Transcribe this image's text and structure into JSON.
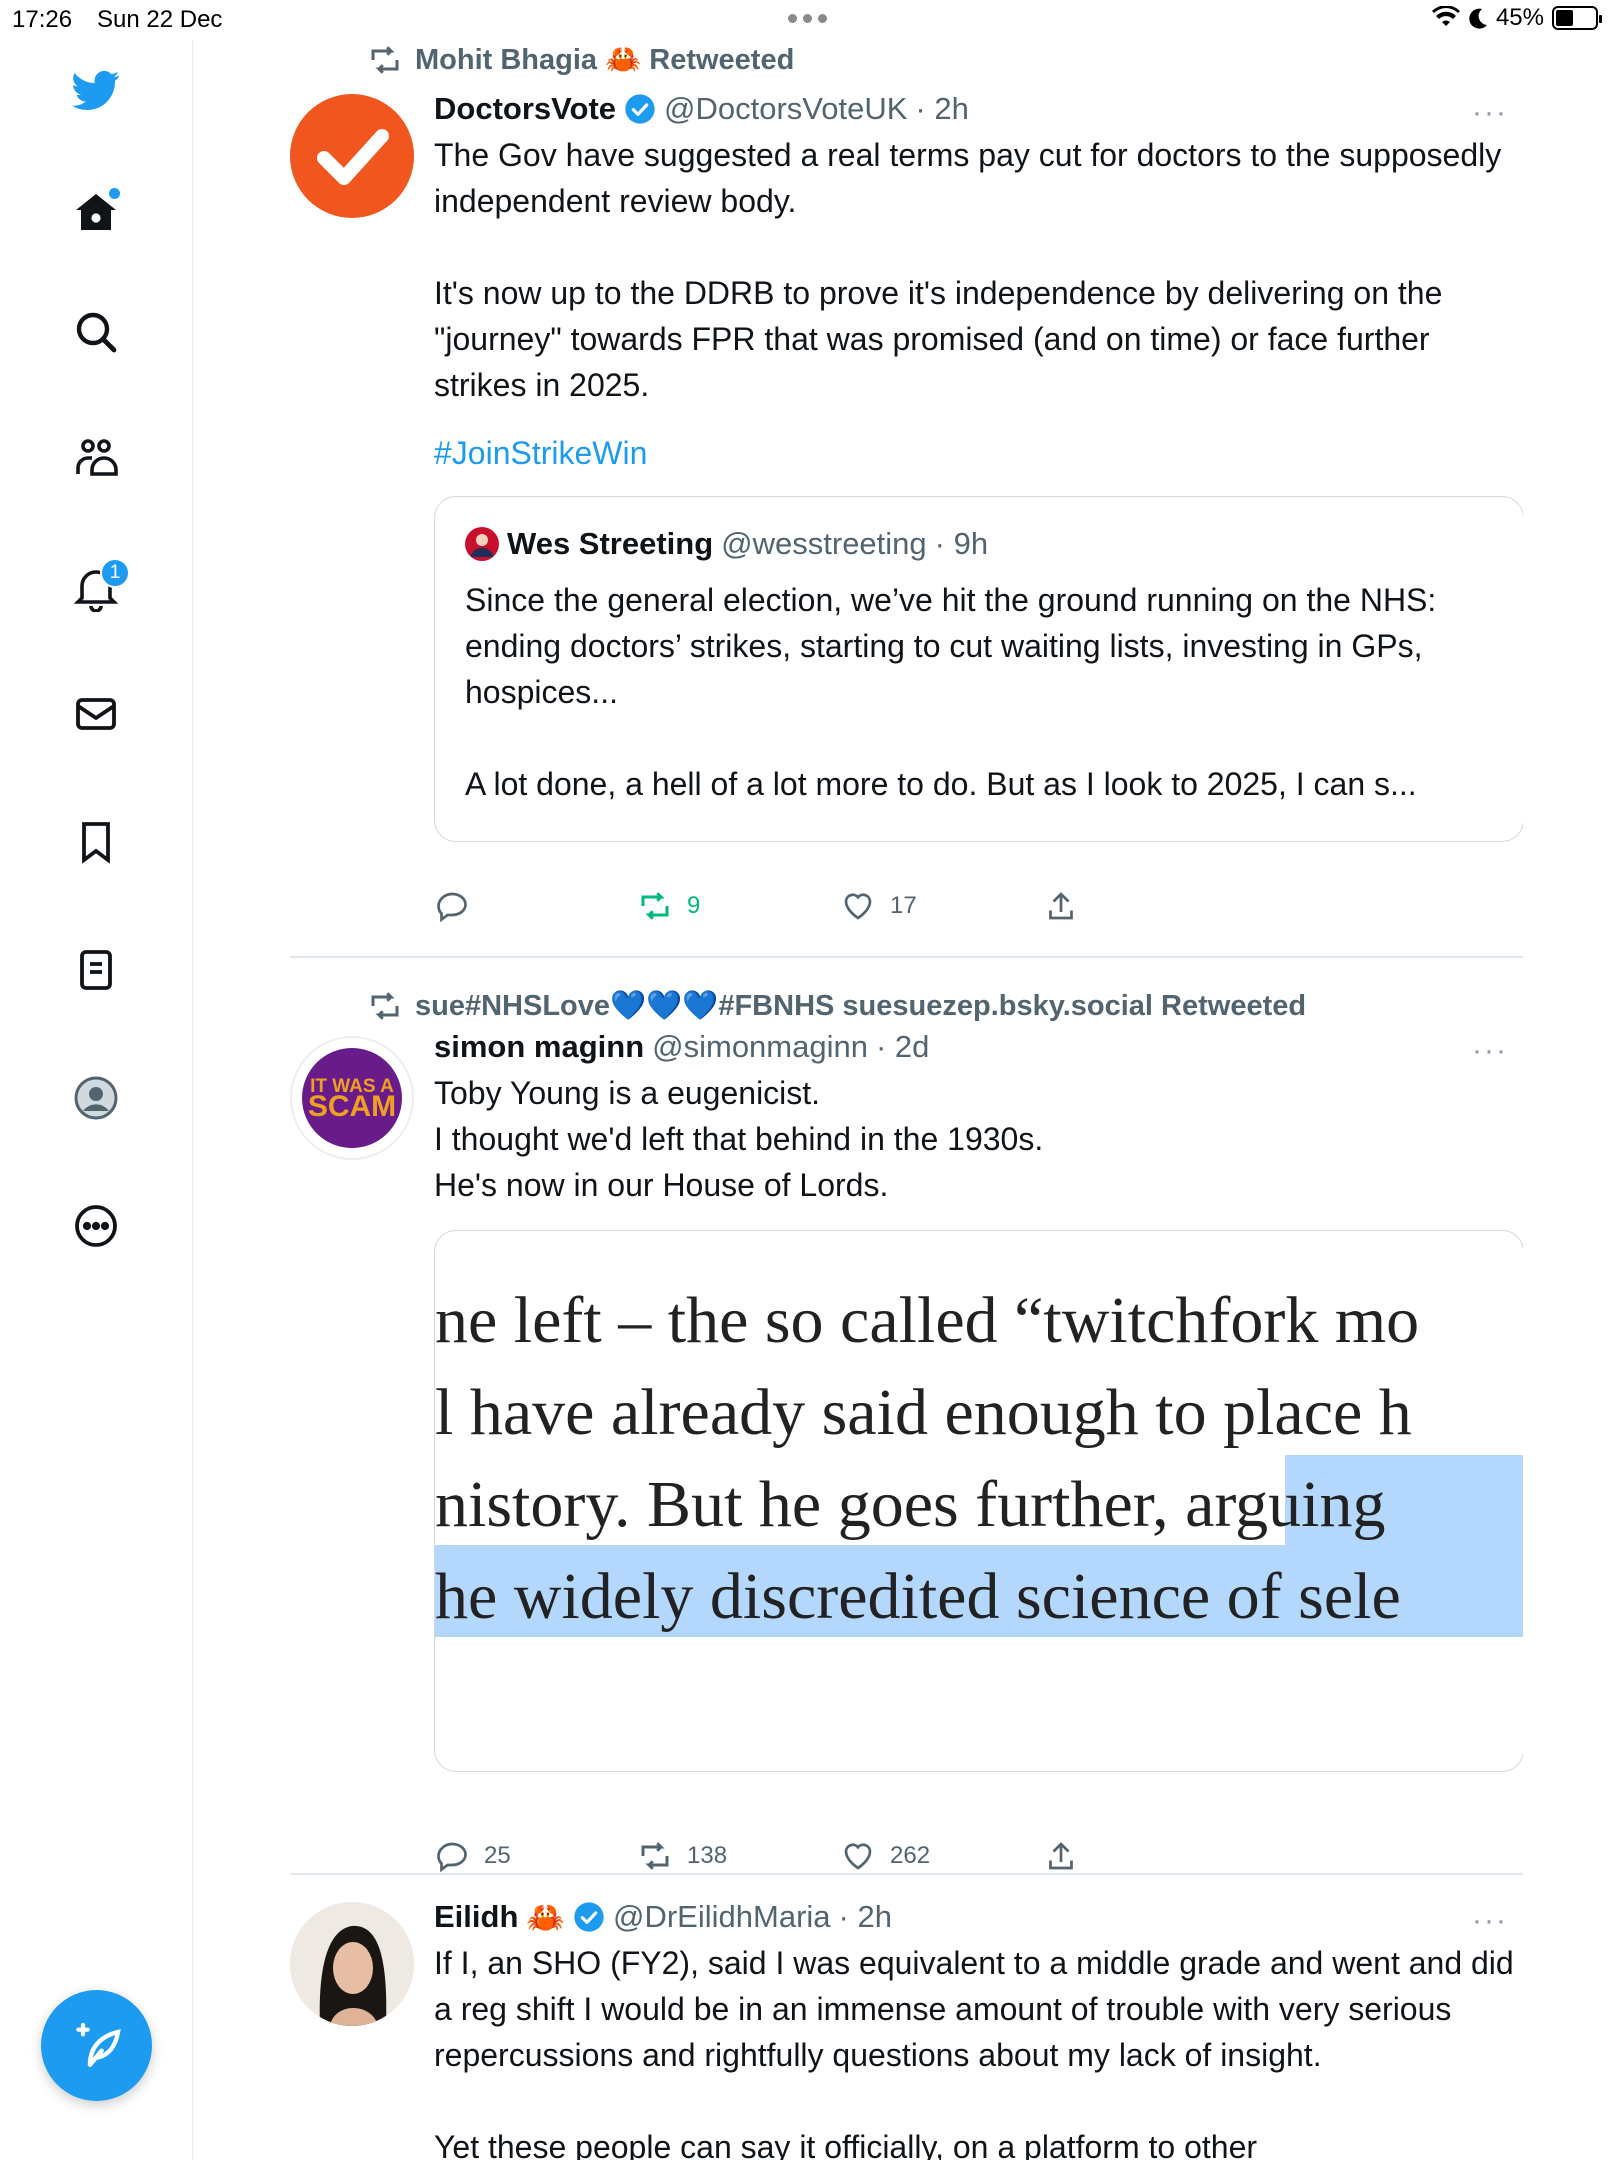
{
  "status_bar": {
    "time": "17:26",
    "date": "Sun 22 Dec",
    "battery": "45%"
  },
  "sidebar": {
    "notifications_badge": "1"
  },
  "tweets": [
    {
      "retweeted_by": "Mohit Bhagia 🦀 Retweeted",
      "name": "DoctorsVote",
      "handle": "@DoctorsVoteUK",
      "time": "· 2h",
      "text": "The Gov have suggested a real terms pay cut for doctors to the supposedly independent review body.\n\nIt's now up to the DDRB to prove it's independence by delivering on the \"journey\" towards FPR that was promised (and on time) or face further strikes in 2025.",
      "hashtag": "#JoinStrikeWin",
      "quote": {
        "name": "Wes Streeting",
        "handle": "@wesstreeting",
        "time": "· 9h",
        "text": "Since the general election, we’ve hit the ground running on the NHS: ending doctors’ strikes, starting to cut waiting lists, investing in GPs, hospices...\n\nA lot done, a hell of a lot more to do. But as I look to 2025, I can s..."
      },
      "stats": {
        "replies": "",
        "retweets": "9",
        "likes": "17"
      }
    },
    {
      "retweeted_by": "sue#NHSLove💙💙💙#FBNHS suesuezep.bsky.social Retweeted",
      "name": "simon maginn",
      "handle": "@simonmaginn",
      "time": "· 2d",
      "avatar_text": [
        "IT WAS A",
        "SCAM"
      ],
      "text": "Toby Young is a eugenicist.\nI thought we'd left that behind in the 1930s.\nHe's now in our House of Lords.",
      "image_lines": [
        "ne left – the so called “twitchfork mo",
        "l have already said enough to place h",
        "nistory. But he goes further, arguing",
        "he widely discredited science of sele"
      ],
      "stats": {
        "replies": "25",
        "retweets": "138",
        "likes": "262"
      }
    },
    {
      "name": "Eilidh",
      "emoji": "🦀",
      "handle": "@DrEilidhMaria",
      "time": "· 2h",
      "text": "If I, an SHO (FY2), said I was equivalent to a middle grade and went and did a reg shift I would be in an immense amount of trouble with very serious repercussions and rightfully questions about my lack of insight.\n\nYet these people can say it officially, on a platform to other"
    }
  ]
}
